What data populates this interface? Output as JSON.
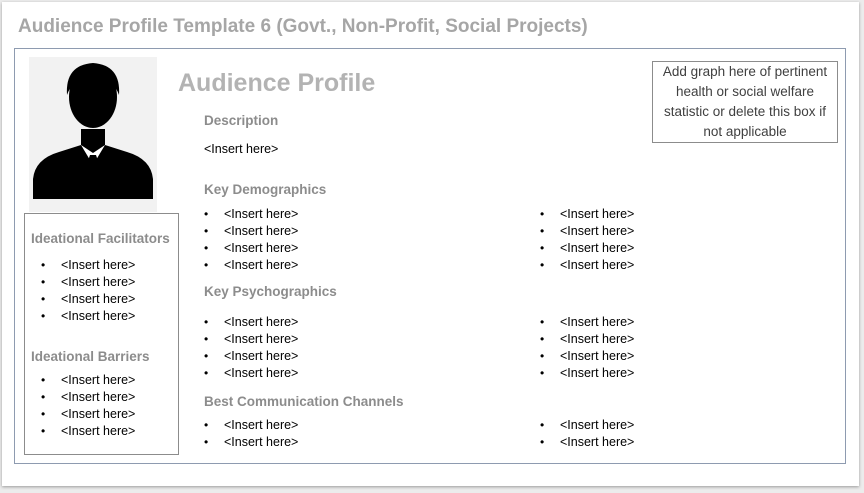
{
  "slide_title": "Audience Profile Template 6 (Govt., Non-Profit, Social Projects)",
  "profile_title": "Audience Profile",
  "graph_placeholder": "Add graph here of pertinent health or social welfare statistic or delete this box if not applicable",
  "avatar_icon": "person-silhouette-icon",
  "sidebar": {
    "facilitators": {
      "heading": "Ideational Facilitators",
      "items": [
        "<Insert here>",
        "<Insert here>",
        "<Insert here>",
        "<Insert here>"
      ]
    },
    "barriers": {
      "heading": "Ideational Barriers",
      "items": [
        "<Insert here>",
        "<Insert here>",
        "<Insert here>",
        "<Insert here>"
      ]
    }
  },
  "description": {
    "heading": "Description",
    "text": "<Insert here>"
  },
  "demographics": {
    "heading": "Key Demographics",
    "left": [
      "<Insert here>",
      "<Insert here>",
      "<Insert here>",
      "<Insert here>"
    ],
    "right": [
      "<Insert here>",
      "<Insert here>",
      "<Insert here>",
      "<Insert here>"
    ]
  },
  "psychographics": {
    "heading": "Key Psychographics",
    "left": [
      "<Insert here>",
      "<Insert here>",
      "<Insert here>",
      "<Insert here>"
    ],
    "right": [
      "<Insert here>",
      "<Insert here>",
      "<Insert here>",
      "<Insert here>"
    ]
  },
  "channels": {
    "heading": "Best Communication Channels",
    "left": [
      "<Insert here>",
      "<Insert here>"
    ],
    "right": [
      "<Insert here>",
      "<Insert here>"
    ]
  }
}
